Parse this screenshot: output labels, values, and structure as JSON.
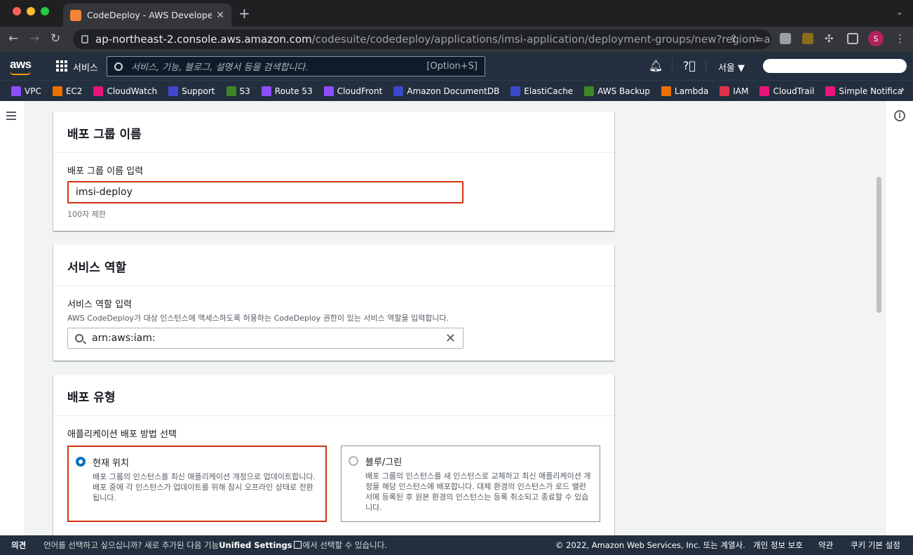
{
  "browser": {
    "tab_title": "CodeDeploy - AWS Developer",
    "url_host": "ap-northeast-2.console.aws.amazon.com",
    "url_path": "/codesuite/codedeploy/applications/imsi-application/deployment-groups/new?region=ap-n..."
  },
  "awsnav": {
    "logo": "aws",
    "services_label": "서비스",
    "search_placeholder": "서비스, 기능, 블로그, 설명서 등을 검색합니다.",
    "search_shortcut": "[Option+S]",
    "region": "서울 ▼"
  },
  "favorites": [
    {
      "label": "VPC",
      "color": "#8c4fff"
    },
    {
      "label": "EC2",
      "color": "#ed7100"
    },
    {
      "label": "CloudWatch",
      "color": "#e7157b"
    },
    {
      "label": "Support",
      "color": "#3f48cc"
    },
    {
      "label": "S3",
      "color": "#3f8624"
    },
    {
      "label": "Route 53",
      "color": "#8c4fff"
    },
    {
      "label": "CloudFront",
      "color": "#8c4fff"
    },
    {
      "label": "Amazon DocumentDB",
      "color": "#3b48cc"
    },
    {
      "label": "ElastiCache",
      "color": "#3b48cc"
    },
    {
      "label": "AWS Backup",
      "color": "#3f8624"
    },
    {
      "label": "Lambda",
      "color": "#ed7100"
    },
    {
      "label": "IAM",
      "color": "#dd344c"
    },
    {
      "label": "CloudTrail",
      "color": "#e7157b"
    },
    {
      "label": "Simple Notifica",
      "color": "#e7157b"
    }
  ],
  "deployment_group_name": {
    "header": "배포 그룹 이름",
    "label": "배포 그룹 이름 입력",
    "value": "imsi-deploy",
    "constraint": "100자 제한"
  },
  "service_role": {
    "header": "서비스 역할",
    "label": "서비스 역할 입력",
    "description": "AWS CodeDeploy가 대상 인스턴스에 액세스하도록 허용하는 CodeDeploy 권한이 있는 서비스 역할을 입력합니다.",
    "value": "arn:aws:iam:"
  },
  "deployment_type": {
    "header": "배포 유형",
    "label": "애플리케이션 배포 방법 선택",
    "options": [
      {
        "title": "현재 위치",
        "description": "배포 그룹의 인스턴스를 최신 애플리케이션 개정으로 업데이트합니다. 배포 중에 각 인스턴스가 업데이트를 위해 잠시 오프라인 상태로 전환됩니다.",
        "selected": true
      },
      {
        "title": "블루/그린",
        "description": "배포 그룹의 인스턴스를 새 인스턴스로 교체하고 최신 애플리케이션 개정을 해당 인스턴스에 배포합니다. 대체 환경의 인스턴스가 로드 밸런서에 등록된 후 원본 환경의 인스턴스는 등록 취소되고 종료할 수 있습니다.",
        "selected": false
      }
    ]
  },
  "footer": {
    "feedback": "의견",
    "language_prefix": "언어를 선택하고 싶으십니까? 새로 추가된 다음 기능",
    "unified_settings": "Unified Settings",
    "language_suffix": "에서 선택할 수 있습니다.",
    "copyright": "© 2022, Amazon Web Services, Inc. 또는 계열사.",
    "privacy": "개인 정보 보호",
    "terms": "약관",
    "cookies": "쿠키 기본 설정"
  }
}
